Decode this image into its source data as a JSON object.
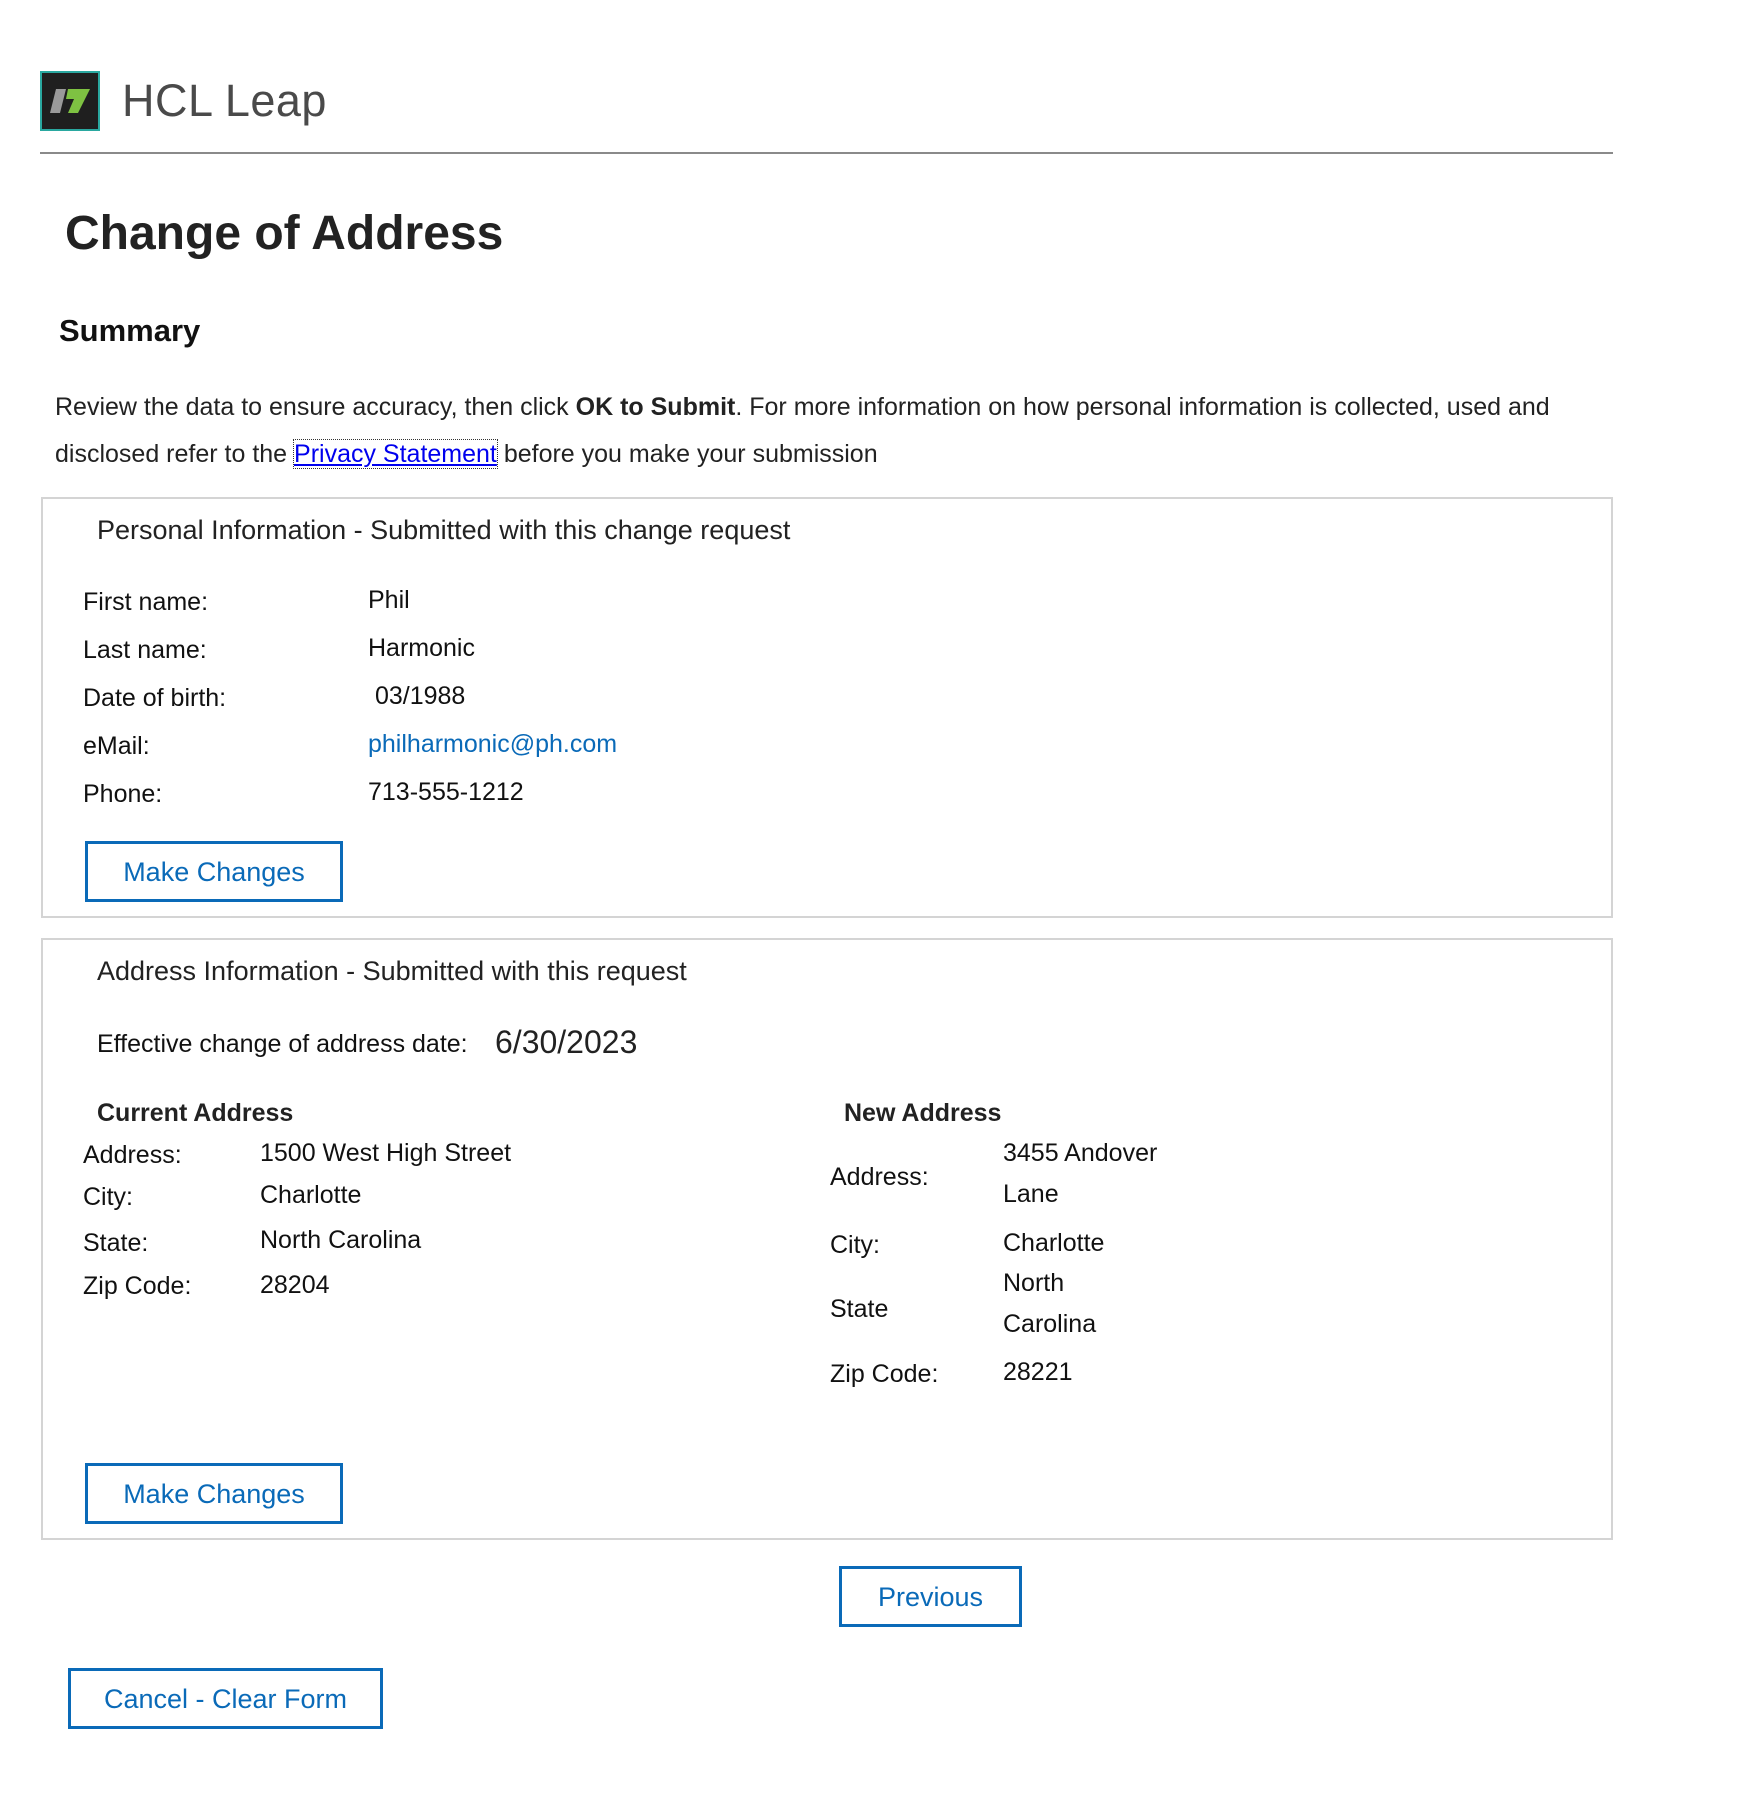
{
  "header": {
    "brand_name": "HCL Leap",
    "logo_icon": "hcl-leap-logo-icon",
    "colors": {
      "logo_border": "#2aa8a0",
      "logo_bg": "#1f1f1f",
      "logo_green": "#7ec242",
      "logo_grey": "#9a9a9a"
    }
  },
  "page": {
    "title": "Change of Address",
    "section_title": "Summary",
    "intro": {
      "text_before": "Review the data to ensure accuracy, then click ",
      "bold": "OK to Submit",
      "text_middle": ". For more information on how personal information is collected, used and disclosed refer to the ",
      "link": "Privacy Statement",
      "text_after": " before you make your submission"
    }
  },
  "personal": {
    "legend": "Personal Information - Submitted with this change request",
    "first_name": {
      "label": "First name:",
      "value": "Phil"
    },
    "last_name": {
      "label": "Last name:",
      "value": "Harmonic"
    },
    "dob": {
      "label": "Date of birth:",
      "value": " 03/1988"
    },
    "email": {
      "label": "eMail:",
      "value": "philharmonic@ph.com"
    },
    "phone": {
      "label": "Phone:",
      "value": "713-555-1212"
    },
    "make_changes": "Make Changes"
  },
  "address": {
    "legend": "Address Information - Submitted with this request",
    "effective_label": "Effective change of address date:",
    "effective_value": "6/30/2023",
    "current": {
      "heading": "Current Address",
      "address": {
        "label": "Address:",
        "value": "1500 West High Street"
      },
      "city": {
        "label": "City:",
        "value": "Charlotte"
      },
      "state": {
        "label": "State:",
        "value": "North Carolina"
      },
      "zip": {
        "label": "Zip Code:",
        "value": "28204"
      }
    },
    "new": {
      "heading": "New Address",
      "address": {
        "label": "Address:",
        "value": "3455 Andover Lane"
      },
      "city": {
        "label": "City:",
        "value": "Charlotte"
      },
      "state": {
        "label": "State",
        "value": "North Carolina"
      },
      "zip": {
        "label": "Zip Code:",
        "value": "28221"
      }
    },
    "make_changes": "Make Changes"
  },
  "footer": {
    "previous": "Previous",
    "cancel": "Cancel - Clear Form"
  },
  "colors": {
    "accent": "#0a6ab8",
    "link": "#0000ee",
    "panel_border": "#d4d4d4",
    "rule": "#8a8a8a"
  }
}
